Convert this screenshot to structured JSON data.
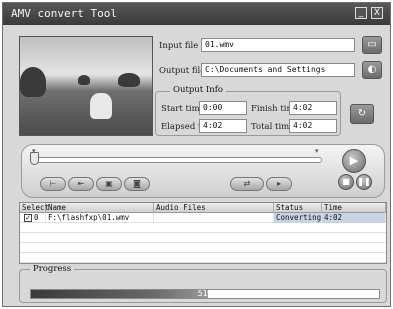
{
  "window": {
    "title": "AMV convert Tool",
    "minimize": "_",
    "close": "X"
  },
  "input": {
    "label": "Input file",
    "value": "01.wmv"
  },
  "output": {
    "label": "Output file",
    "value": "C:\\Documents and Settings"
  },
  "output_info": {
    "title": "Output Info",
    "start_time_label": "Start time",
    "start_time": "0:00",
    "finish_time_label": "Finish time",
    "finish_time": "4:02",
    "elapsed_time_label": "Elapsed time",
    "elapsed_time": "4:02",
    "total_time_label": "Total time",
    "total_time": "4:02"
  },
  "table": {
    "columns": [
      "Select",
      "Name",
      "Audio Files",
      "Status",
      "Time"
    ],
    "rows": [
      {
        "select": "0",
        "name": "F:\\flashfxp\\01.wmv",
        "audio": "",
        "status": "Converting",
        "time": "4:02"
      }
    ]
  },
  "progress": {
    "title": "Progress",
    "value": 0.51,
    "text": "51%"
  }
}
